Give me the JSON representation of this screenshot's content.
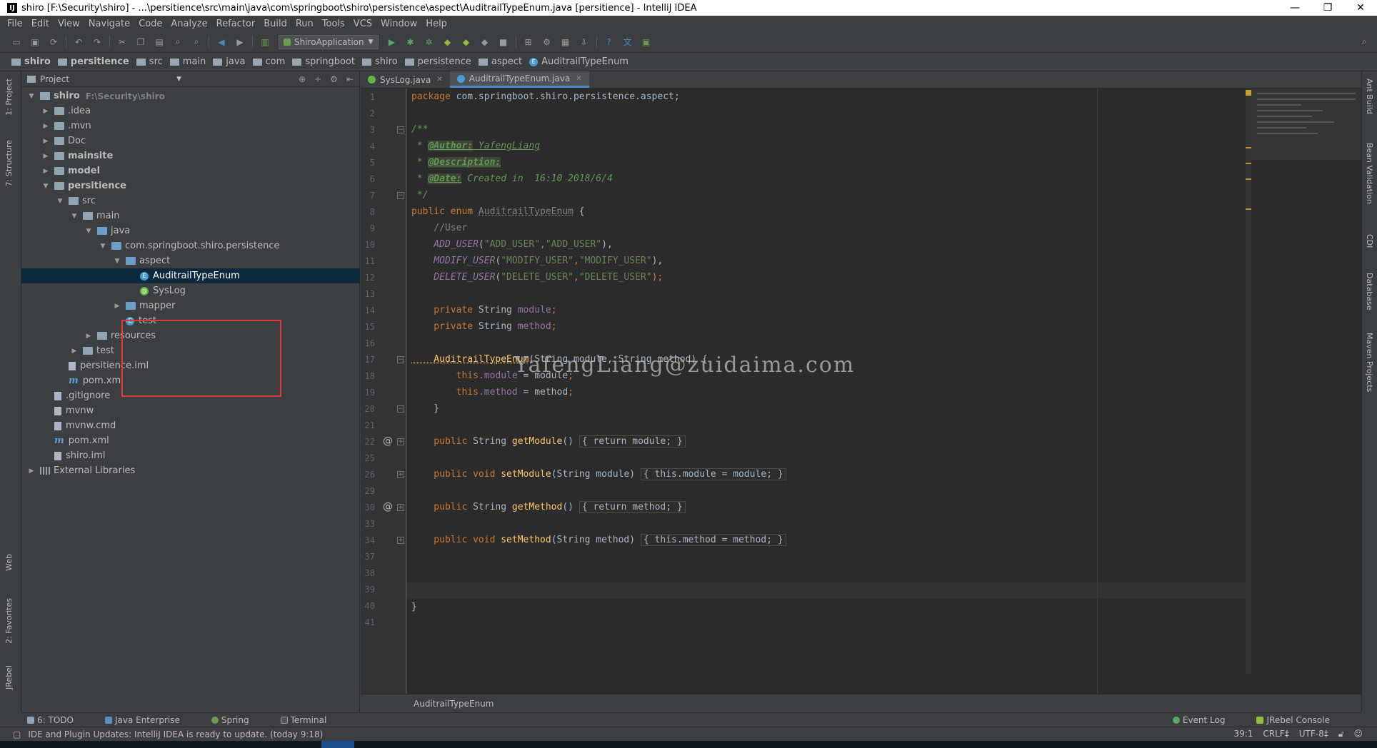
{
  "window": {
    "title": "shiro [F:\\Security\\shiro] - ...\\persitience\\src\\main\\java\\com\\springboot\\shiro\\persistence\\aspect\\AuditrailTypeEnum.java [persitience] - IntelliJ IDEA",
    "logo": "IJ",
    "controls": [
      "—",
      "❐",
      "✕"
    ]
  },
  "menu": [
    "File",
    "Edit",
    "View",
    "Navigate",
    "Code",
    "Analyze",
    "Refactor",
    "Build",
    "Run",
    "Tools",
    "VCS",
    "Window",
    "Help"
  ],
  "toolbar": {
    "run_config": "ShiroApplication"
  },
  "breadcrumbs": [
    "shiro",
    "persitience",
    "src",
    "main",
    "java",
    "com",
    "springboot",
    "shiro",
    "persistence",
    "aspect",
    "AuditrailTypeEnum"
  ],
  "left_strip": {
    "project": "1: Project",
    "structure": "7: Structure",
    "web": "Web",
    "favorites": "2: Favorites",
    "jrebel": "JRebel"
  },
  "right_strip": {
    "ant": "Ant Build",
    "bean": "Bean Validation",
    "cdi": "CDI",
    "database": "Database",
    "maven": "Maven Projects"
  },
  "project_panel": {
    "title": "Project",
    "tree": [
      {
        "label": "shiro",
        "path": "F:\\Security\\shiro",
        "depth": 0,
        "arrow": "▼",
        "icon": "folder",
        "bold": true
      },
      {
        "label": ".idea",
        "depth": 1,
        "arrow": "▶",
        "icon": "folder"
      },
      {
        "label": ".mvn",
        "depth": 1,
        "arrow": "▶",
        "icon": "folder"
      },
      {
        "label": "Doc",
        "depth": 1,
        "arrow": "▶",
        "icon": "folder"
      },
      {
        "label": "mainsite",
        "depth": 1,
        "arrow": "▶",
        "icon": "folder",
        "bold": true
      },
      {
        "label": "model",
        "depth": 1,
        "arrow": "▶",
        "icon": "folder",
        "bold": true
      },
      {
        "label": "persitience",
        "depth": 1,
        "arrow": "▼",
        "icon": "folder",
        "bold": true
      },
      {
        "label": "src",
        "depth": 2,
        "arrow": "▼",
        "icon": "folder"
      },
      {
        "label": "main",
        "depth": 3,
        "arrow": "▼",
        "icon": "folder"
      },
      {
        "label": "java",
        "depth": 4,
        "arrow": "▼",
        "icon": "src"
      },
      {
        "label": "com.springboot.shiro.persistence",
        "depth": 5,
        "arrow": "▼",
        "icon": "package"
      },
      {
        "label": "aspect",
        "depth": 6,
        "arrow": "▼",
        "icon": "package"
      },
      {
        "label": "AuditrailTypeEnum",
        "depth": 7,
        "arrow": "",
        "icon": "enum",
        "selected": true
      },
      {
        "label": "SysLog",
        "depth": 7,
        "arrow": "",
        "icon": "annotation"
      },
      {
        "label": "mapper",
        "depth": 6,
        "arrow": "▶",
        "icon": "package"
      },
      {
        "label": "test",
        "depth": 6,
        "arrow": "",
        "icon": "class"
      },
      {
        "label": "resources",
        "depth": 4,
        "arrow": "▶",
        "icon": "folder"
      },
      {
        "label": "test",
        "depth": 3,
        "arrow": "▶",
        "icon": "folder"
      },
      {
        "label": "persitience.iml",
        "depth": 2,
        "arrow": "",
        "icon": "file"
      },
      {
        "label": "pom.xml",
        "depth": 2,
        "arrow": "",
        "icon": "maven"
      },
      {
        "label": ".gitignore",
        "depth": 1,
        "arrow": "",
        "icon": "file"
      },
      {
        "label": "mvnw",
        "depth": 1,
        "arrow": "",
        "icon": "file"
      },
      {
        "label": "mvnw.cmd",
        "depth": 1,
        "arrow": "",
        "icon": "file"
      },
      {
        "label": "pom.xml",
        "depth": 1,
        "arrow": "",
        "icon": "maven"
      },
      {
        "label": "shiro.iml",
        "depth": 1,
        "arrow": "",
        "icon": "file"
      },
      {
        "label": "External Libraries",
        "depth": 0,
        "arrow": "▶",
        "icon": "libraries"
      }
    ]
  },
  "editor_tabs": [
    {
      "label": "SysLog.java",
      "icon": "annotation",
      "active": false
    },
    {
      "label": "AuditrailTypeEnum.java",
      "icon": "enum",
      "active": true
    }
  ],
  "code": {
    "line_numbers": [
      "1",
      "2",
      "3",
      "4",
      "5",
      "6",
      "7",
      "8",
      "9",
      "10",
      "11",
      "12",
      "13",
      "14",
      "15",
      "16",
      "17",
      "18",
      "19",
      "20",
      "21",
      "22",
      "25",
      "26",
      "29",
      "30",
      "33",
      "34",
      "37",
      "38",
      "39",
      "40",
      "41"
    ],
    "l1_kw": "package",
    "l1_rest": " com.springboot.shiro.persistence.aspect;",
    "l3": "/**",
    "l4_pre": " * ",
    "l4_tag": "@Author:",
    "l4_rest": " YafengLiang",
    "l5_pre": " * ",
    "l5_tag": "@Description:",
    "l6_pre": " * ",
    "l6_tag": "@Date:",
    "l6_rest": " Created in  16:10 2018/6/4",
    "l7": " */",
    "l8_kw": "public enum ",
    "l8_name": "AuditrailTypeEnum",
    "l8_rest": " {",
    "l9": "    //User",
    "l10_c": "    ADD_USER",
    "l10_p1": "(",
    "l10_s1": "\"ADD_USER\"",
    "l10_p2": ",",
    "l10_s2": "\"ADD_USER\"",
    "l10_p3": "),",
    "l11_c": "    MODIFY_USER",
    "l11_p1": "(",
    "l11_s1": "\"MODIFY_USER\"",
    "l11_p2": ",",
    "l11_s2": "\"MODIFY_USER\"",
    "l11_p3": "),",
    "l12_c": "    DELETE_USER",
    "l12_p1": "(",
    "l12_s1": "\"DELETE_USER\"",
    "l12_p2": ",",
    "l12_s2": "\"DELETE_USER\"",
    "l12_p3": ");",
    "l14_kw": "    private ",
    "l14_t": "String ",
    "l14_f": "module",
    "l14_e": ";",
    "l15_kw": "    private ",
    "l15_t": "String ",
    "l15_f": "method",
    "l15_e": ";",
    "l17_name": "    AuditrailTypeEnum",
    "l17_rest": "(String module, String method) {",
    "l18_kw": "        this",
    "l18_f": ".module",
    "l18_rest": " = module",
    "l18_e": ";",
    "l19_kw": "        this",
    "l19_f": ".method",
    "l19_rest": " = method",
    "l19_e": ";",
    "l20": "    }",
    "l22_kw": "    public ",
    "l22_t": "String ",
    "l22_fn": "getModule",
    "l22_p": "() ",
    "l22_b": "{ return module; }",
    "l26_kw": "    public void ",
    "l26_fn": "setModule",
    "l26_p": "(String module) ",
    "l26_b": "{ this.module = module; }",
    "l30_kw": "    public ",
    "l30_t": "String ",
    "l30_fn": "getMethod",
    "l30_p": "() ",
    "l30_b": "{ return method; }",
    "l34_kw": "    public void ",
    "l34_fn": "setMethod",
    "l34_p": "(String method) ",
    "l34_b": "{ this.method = method; }",
    "l40": "}"
  },
  "watermark": "YafengLiang@zuidaima.com",
  "editor_breadcrumb": "AuditrailTypeEnum",
  "bottom_tools": {
    "todo": "6: TODO",
    "java_ee": "Java Enterprise",
    "spring": "Spring",
    "terminal": "Terminal",
    "event_log": "Event Log",
    "jrebel_console": "JRebel Console"
  },
  "status": {
    "message": "IDE and Plugin Updates: IntelliJ IDEA is ready to update. (today 9:18)",
    "position": "39:1",
    "line_sep": "CRLF‡",
    "encoding": "UTF-8‡"
  }
}
